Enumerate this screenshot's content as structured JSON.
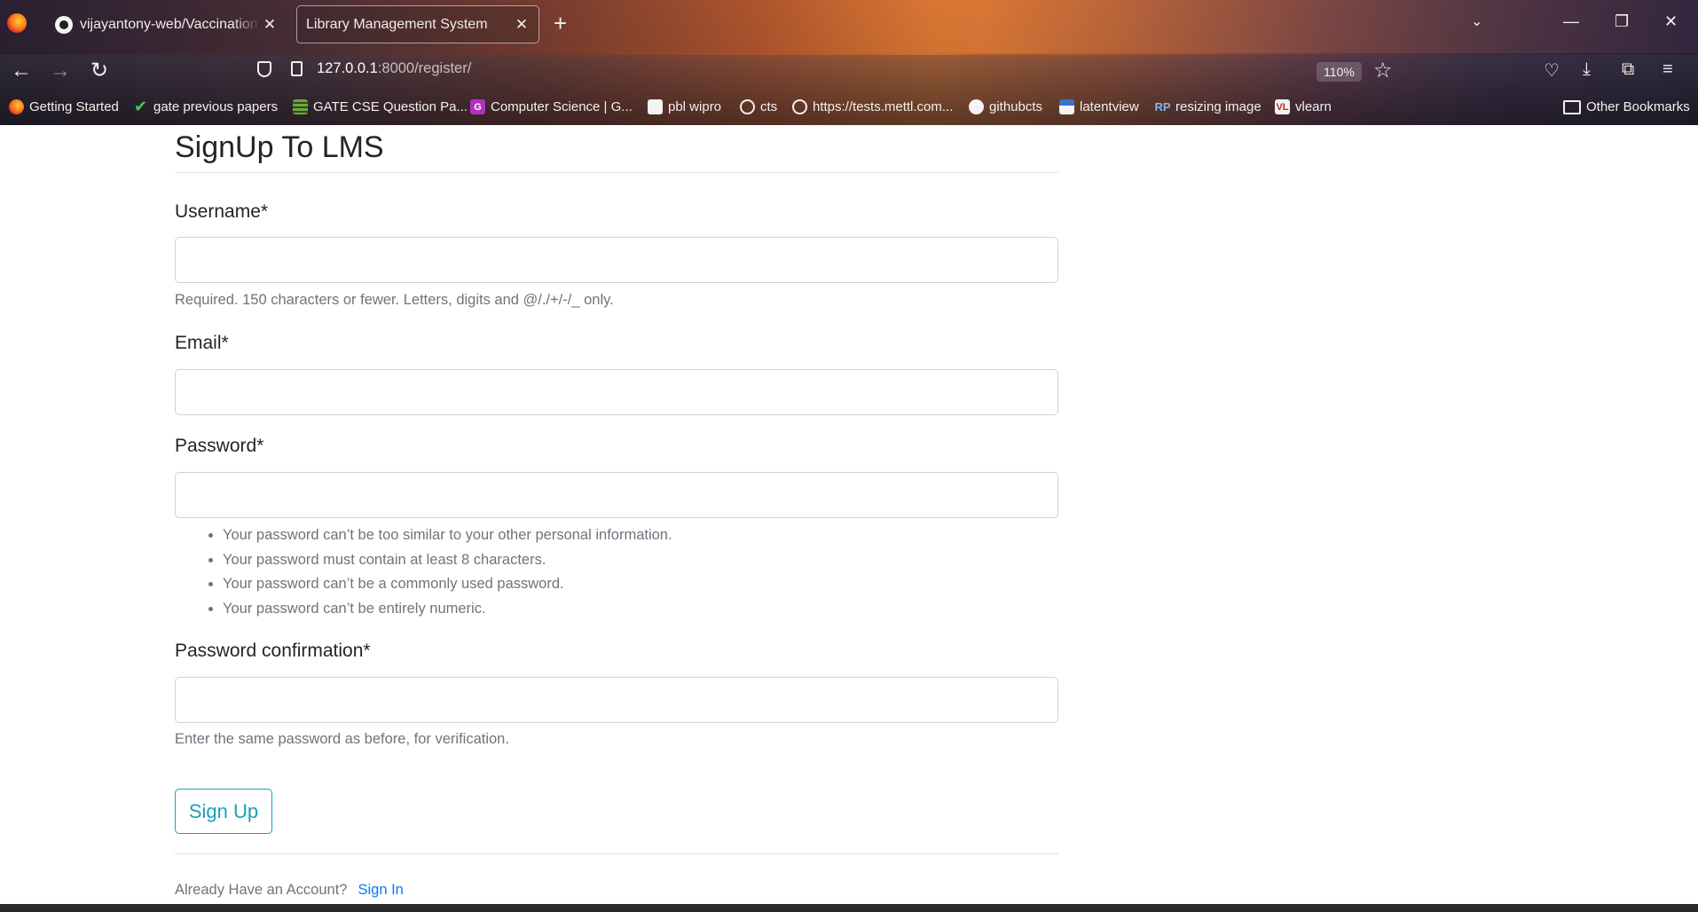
{
  "browser": {
    "tabs": [
      {
        "title": "vijayantony-web/Vaccination_B",
        "active": false
      },
      {
        "title": "Library Management System",
        "active": true
      }
    ],
    "new_tab_glyph": "+",
    "close_glyph": "✕",
    "url": {
      "host": "127.0.0.1",
      "rest": ":8000/register/"
    },
    "zoom": "110%",
    "bookmarks": [
      {
        "label": "Getting Started",
        "icon": "firefox-icon"
      },
      {
        "label": "gate previous papers",
        "icon": "check-icon"
      },
      {
        "label": "GATE CSE Question Pa...",
        "icon": "stack-icon"
      },
      {
        "label": "Computer Science | G...",
        "icon": "g-icon"
      },
      {
        "label": "pbl wipro",
        "icon": "doc-icon"
      },
      {
        "label": "cts",
        "icon": "globe-icon"
      },
      {
        "label": "https://tests.mettl.com...",
        "icon": "globe-icon"
      },
      {
        "label": "githubcts",
        "icon": "github-icon"
      },
      {
        "label": "latentview",
        "icon": "latentview-icon"
      },
      {
        "label": "resizing image",
        "icon": "rp-icon"
      },
      {
        "label": "vlearn",
        "icon": "vlearn-icon"
      }
    ],
    "other_bookmarks": "Other Bookmarks",
    "icon_glyphs": {
      "g": "G",
      "rp": "RP",
      "vl": "VL"
    }
  },
  "form": {
    "legend": "SignUp To LMS",
    "username": {
      "label": "Username*",
      "value": "",
      "help": "Required. 150 characters or fewer. Letters, digits and @/./+/-/_ only."
    },
    "email": {
      "label": "Email*",
      "value": ""
    },
    "password": {
      "label": "Password*",
      "value": "",
      "help": [
        "Your password can’t be too similar to your other personal information.",
        "Your password must contain at least 8 characters.",
        "Your password can’t be a commonly used password.",
        "Your password can’t be entirely numeric."
      ]
    },
    "password_confirmation": {
      "label": "Password confirmation*",
      "value": "",
      "help": "Enter the same password as before, for verification."
    },
    "submit_label": "Sign Up",
    "footer_text": "Already Have an Account?",
    "signin_link": "Sign In"
  },
  "colors": {
    "accent_info": "#17a2b8",
    "link": "#007bff",
    "muted": "#6c757d",
    "text": "#212529"
  }
}
